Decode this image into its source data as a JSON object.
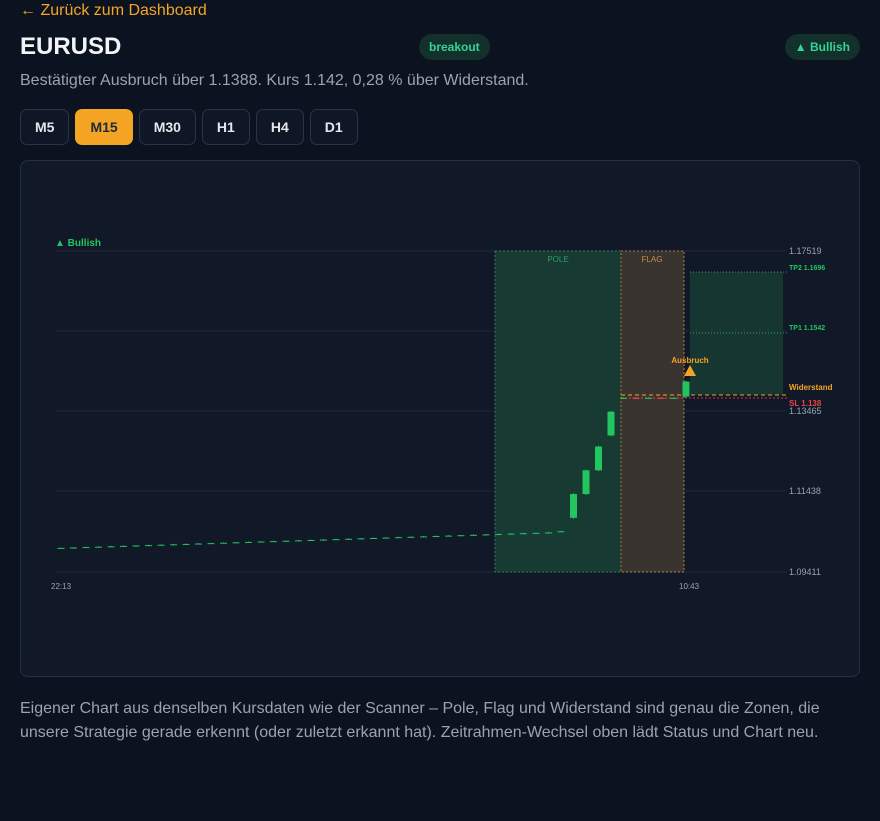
{
  "nav": {
    "back_label": "← Zurück zum Dashboard"
  },
  "header": {
    "symbol": "EURUSD",
    "pattern_badge": "breakout",
    "bias_badge": "▲ Bullish",
    "status_text": "Bestätigter Ausbruch über 1.1388. Kurs 1.142, 0,28 % über Widerstand."
  },
  "timeframes": {
    "items": [
      "M5",
      "M15",
      "M30",
      "H1",
      "H4",
      "D1"
    ],
    "active": "M15"
  },
  "chart": {
    "bias_label": "▲ Bullish",
    "zone_labels": {
      "pole": "POLE",
      "flag": "FLAG"
    },
    "breakout_label": "Ausbruch",
    "level_labels": {
      "tp2": "TP2 1.1696",
      "tp1": "TP1 1.1542",
      "resistance": "Widerstand",
      "sl": "SL 1.138"
    },
    "y_ticks": [
      "1.17519",
      "1.13465",
      "1.11438",
      "1.09411"
    ],
    "x_ticks": [
      "22:13",
      "10:43"
    ],
    "colors": {
      "bull": "#22c55e",
      "accent": "#f5a524",
      "stop": "#ef4444",
      "pole_zone": "#173a33",
      "flag_zone": "#3a3430"
    }
  },
  "chart_data": {
    "type": "candlestick",
    "ylim": [
      1.09411,
      1.17519
    ],
    "y_ticks": [
      1.09411,
      1.11438,
      1.13465,
      1.17519
    ],
    "x_tick_labels": [
      "22:13",
      "10:43"
    ],
    "levels": {
      "tp2": 1.1696,
      "tp1": 1.1542,
      "resistance": 1.1388,
      "stop_loss": 1.138
    },
    "ohlc": [
      [
        1.1001,
        1.1003,
        1.1,
        1.1002
      ],
      [
        1.1002,
        1.1004,
        1.1001,
        1.1003
      ],
      [
        1.1003,
        1.1005,
        1.1002,
        1.1004
      ],
      [
        1.1004,
        1.1006,
        1.1003,
        1.1005
      ],
      [
        1.1005,
        1.1007,
        1.1004,
        1.1006
      ],
      [
        1.1006,
        1.1008,
        1.1005,
        1.1007
      ],
      [
        1.1007,
        1.1009,
        1.1006,
        1.1008
      ],
      [
        1.1008,
        1.101,
        1.1007,
        1.1009
      ],
      [
        1.1009,
        1.1011,
        1.1008,
        1.101
      ],
      [
        1.101,
        1.1012,
        1.1009,
        1.1011
      ],
      [
        1.1011,
        1.1013,
        1.101,
        1.1012
      ],
      [
        1.1012,
        1.1014,
        1.1011,
        1.1013
      ],
      [
        1.1013,
        1.1015,
        1.1012,
        1.1014
      ],
      [
        1.1014,
        1.1016,
        1.1013,
        1.1015
      ],
      [
        1.1015,
        1.1017,
        1.1014,
        1.1016
      ],
      [
        1.1016,
        1.1018,
        1.1015,
        1.1017
      ],
      [
        1.1017,
        1.1019,
        1.1016,
        1.1018
      ],
      [
        1.1018,
        1.102,
        1.1017,
        1.1019
      ],
      [
        1.1019,
        1.1021,
        1.1018,
        1.102
      ],
      [
        1.102,
        1.1022,
        1.1019,
        1.1021
      ],
      [
        1.1021,
        1.1023,
        1.102,
        1.1022
      ],
      [
        1.1022,
        1.1024,
        1.1021,
        1.1023
      ],
      [
        1.1023,
        1.1025,
        1.1022,
        1.1024
      ],
      [
        1.1024,
        1.1026,
        1.1023,
        1.1025
      ],
      [
        1.1025,
        1.1027,
        1.1024,
        1.1026
      ],
      [
        1.1026,
        1.1028,
        1.1025,
        1.1027
      ],
      [
        1.1027,
        1.1029,
        1.1026,
        1.1028
      ],
      [
        1.1028,
        1.103,
        1.1027,
        1.1029
      ],
      [
        1.1029,
        1.1031,
        1.1028,
        1.103
      ],
      [
        1.103,
        1.1032,
        1.1029,
        1.1031
      ],
      [
        1.1031,
        1.1033,
        1.103,
        1.1032
      ],
      [
        1.1032,
        1.1034,
        1.1031,
        1.1033
      ],
      [
        1.1033,
        1.1035,
        1.1032,
        1.1034
      ],
      [
        1.1034,
        1.1036,
        1.1033,
        1.1035
      ],
      [
        1.1035,
        1.1037,
        1.1034,
        1.1036
      ],
      [
        1.1036,
        1.1038,
        1.1035,
        1.1037
      ],
      [
        1.1037,
        1.1039,
        1.1036,
        1.1038
      ],
      [
        1.1038,
        1.104,
        1.1037,
        1.1039
      ],
      [
        1.1039,
        1.1041,
        1.1038,
        1.104
      ],
      [
        1.104,
        1.1042,
        1.1039,
        1.1041
      ],
      [
        1.1044,
        1.1045,
        1.1043,
        1.1044
      ],
      [
        1.1078,
        1.114,
        1.1076,
        1.1138
      ],
      [
        1.1138,
        1.12,
        1.1136,
        1.1198
      ],
      [
        1.1198,
        1.126,
        1.1196,
        1.1258
      ],
      [
        1.1286,
        1.1348,
        1.1284,
        1.1346
      ],
      [
        1.138,
        1.1382,
        1.1378,
        1.1381
      ],
      [
        1.1381,
        1.1383,
        1.1379,
        1.138
      ],
      [
        1.138,
        1.1382,
        1.1378,
        1.1381
      ],
      [
        1.1381,
        1.1383,
        1.1379,
        1.138
      ],
      [
        1.138,
        1.1382,
        1.1378,
        1.1381
      ],
      [
        1.1384,
        1.1424,
        1.1382,
        1.1422
      ]
    ]
  }
}
